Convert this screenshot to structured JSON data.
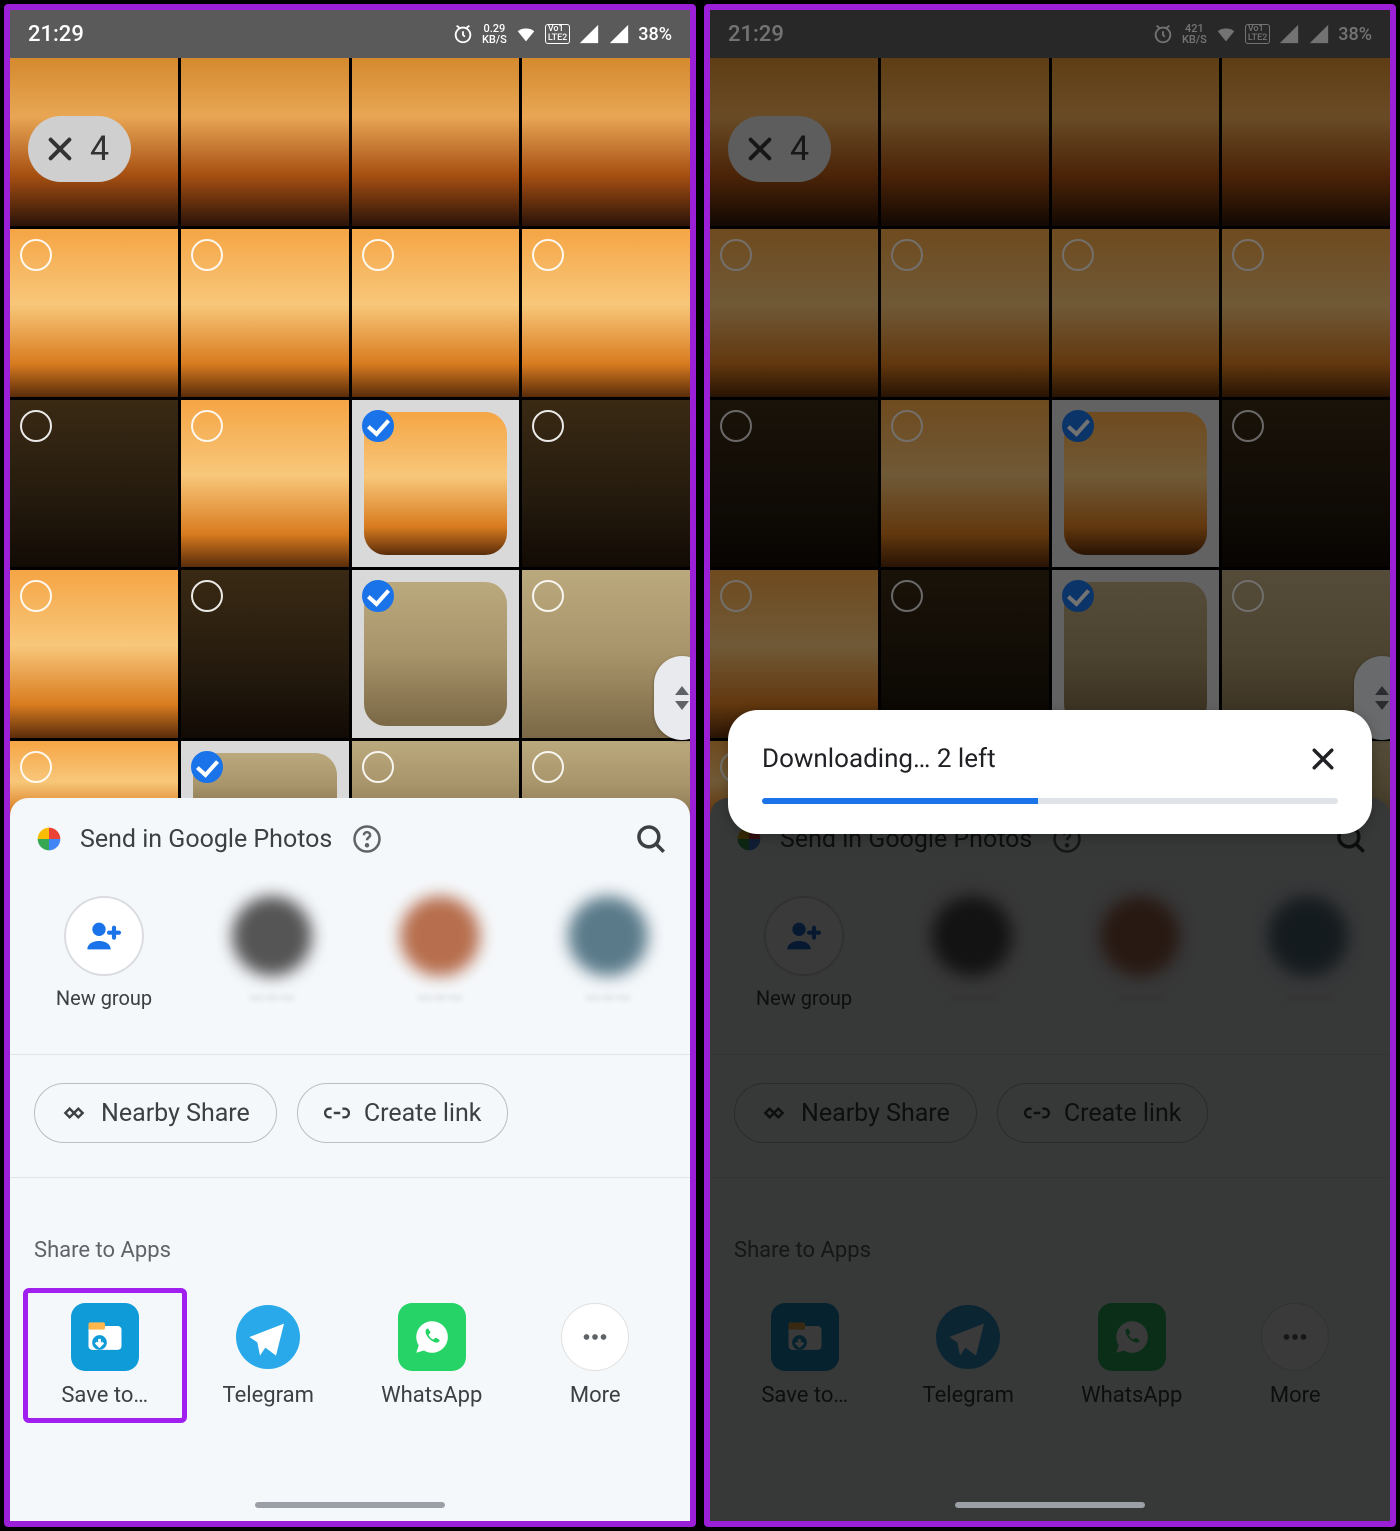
{
  "left": {
    "status": {
      "time": "21:29",
      "net_speed": "0.29",
      "net_unit": "KB/S",
      "battery": "38%"
    },
    "selection_count": "4",
    "sheet": {
      "title": "Send in Google Photos",
      "new_group": "New group",
      "nearby": "Nearby Share",
      "create_link": "Create link",
      "share_apps": "Share to Apps",
      "apps": {
        "save": "Save to…",
        "telegram": "Telegram",
        "whatsapp": "WhatsApp",
        "more": "More"
      }
    }
  },
  "right": {
    "status": {
      "time": "21:29",
      "net_speed": "421",
      "net_unit": "KB/S",
      "battery": "38%"
    },
    "selection_count": "4",
    "toast": {
      "text": "Downloading… 2 left",
      "progress_pct": 48
    },
    "sheet": {
      "title": "Send in Google Photos",
      "new_group": "New group",
      "nearby": "Nearby Share",
      "create_link": "Create link",
      "share_apps": "Share to Apps",
      "apps": {
        "save": "Save to…",
        "telegram": "Telegram",
        "whatsapp": "WhatsApp",
        "more": "More"
      }
    }
  },
  "grid": {
    "rows": [
      [
        "sunset",
        "sunset",
        "sunset",
        "sunset"
      ],
      [
        "orange",
        "orange",
        "orange",
        "orange"
      ],
      [
        "dark",
        "orange",
        "sel-orange",
        "dark"
      ],
      [
        "orange",
        "dark",
        "sel-foggy",
        "foggy"
      ],
      [
        "orange",
        "sel-foggy",
        "foggy",
        "foggy"
      ]
    ],
    "selected": [
      [
        2,
        2
      ],
      [
        3,
        2
      ],
      [
        4,
        1
      ],
      [
        4,
        1
      ]
    ]
  }
}
